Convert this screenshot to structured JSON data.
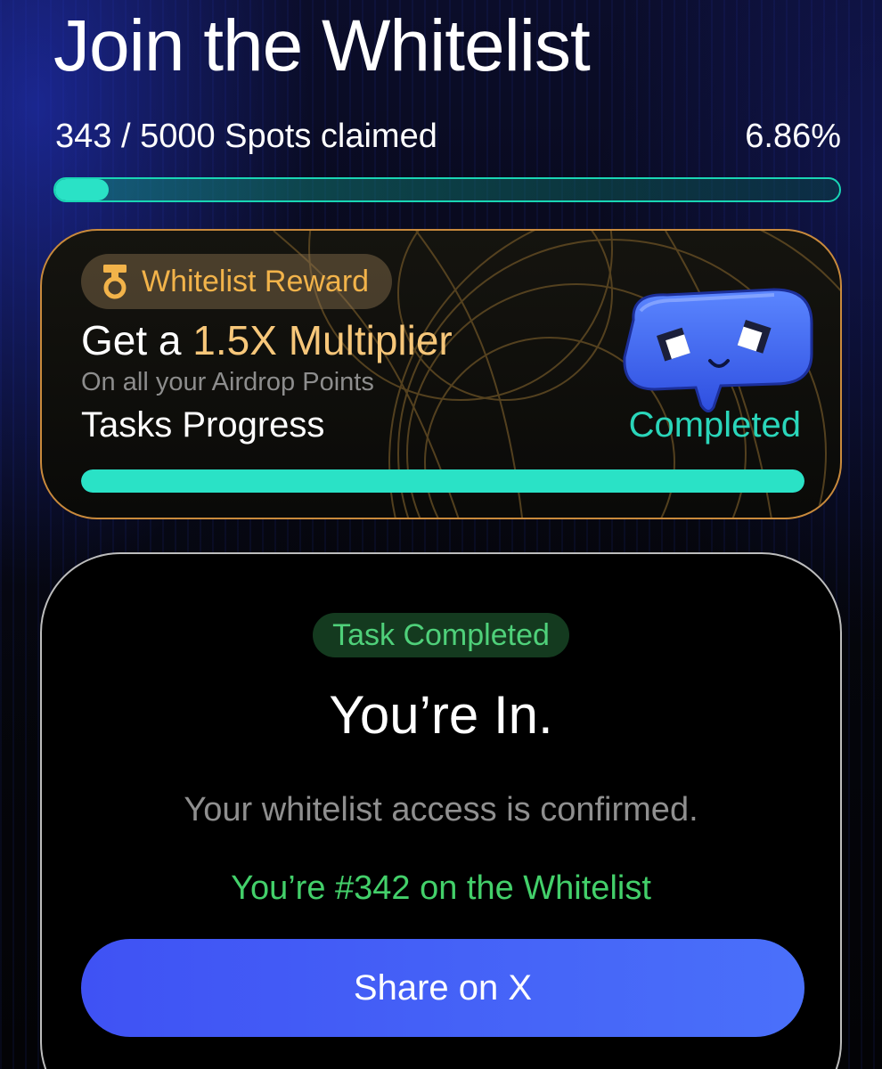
{
  "header": {
    "title": "Join the Whitelist"
  },
  "spots": {
    "claimed_label": "343 / 5000 Spots claimed",
    "percent_label": "6.86%",
    "progress_fraction": 0.0686,
    "accent_color": "#2ae2c6"
  },
  "reward": {
    "badge_label": "Whitelist Reward",
    "badge_icon": "medal-icon",
    "headline_prefix": "Get a ",
    "headline_accent": "1.5X Multiplier",
    "subtitle": "On all your Airdrop Points",
    "tasks_label": "Tasks Progress",
    "tasks_status": "Completed",
    "tasks_progress_fraction": 1.0,
    "mascot_icon": "speech-bubble-mascot-icon",
    "border_color": "#c98a3c"
  },
  "confirmation": {
    "badge_label": "Task Completed",
    "heading": "You’re In.",
    "description": "Your whitelist access is confirmed.",
    "rank_text": "You’re #342 on the Whitelist",
    "share_button_label": "Share on X",
    "success_color": "#43d06a",
    "button_color": "#4a64f8"
  }
}
